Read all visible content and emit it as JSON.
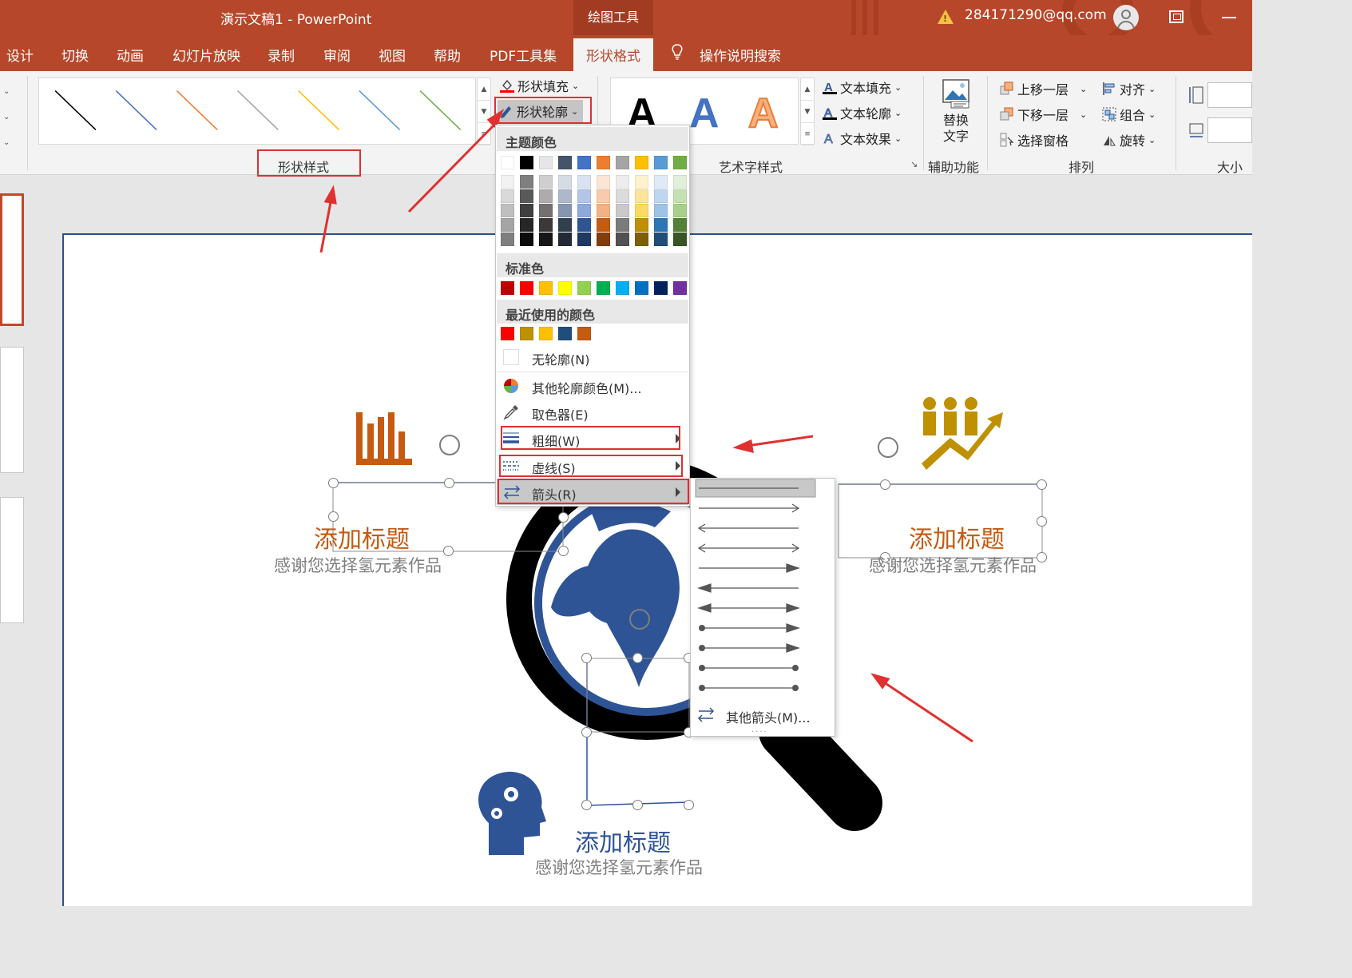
{
  "titlebar": {
    "title": "演示文稿1  -  PowerPoint",
    "context_tool": "绘图工具",
    "account": "284171290@qq.com"
  },
  "tabs": [
    {
      "label": "设计"
    },
    {
      "label": "切换"
    },
    {
      "label": "动画"
    },
    {
      "label": "幻灯片放映"
    },
    {
      "label": "录制"
    },
    {
      "label": "审阅"
    },
    {
      "label": "视图"
    },
    {
      "label": "帮助"
    },
    {
      "label": "PDF工具集"
    },
    {
      "label": "形状格式"
    }
  ],
  "search_tab": "操作说明搜索",
  "ribbon": {
    "shape_fill": "形状填充",
    "shape_outline": "形状轮廓",
    "shape_styles_label": "形状样式",
    "text_fill": "文本填充",
    "text_outline": "文本轮廓",
    "text_effect": "文本效果",
    "wordart_label": "艺术字样式",
    "alt_text_line1": "替换",
    "alt_text_line2": "文字",
    "accessibility_label": "辅助功能",
    "bring_forward": "上移一层",
    "send_backward": "下移一层",
    "selection_pane": "选择窗格",
    "align": "对齐",
    "group": "组合",
    "rotate": "旋转",
    "arrange_label": "排列",
    "size_label": "大小",
    "line_styles": [
      "#000000",
      "#4472c4",
      "#ed7d31",
      "#a5a5a5",
      "#ffc000",
      "#5b9bd5",
      "#70ad47"
    ]
  },
  "dropdown": {
    "theme_colors_header": "主题颜色",
    "theme_top": [
      "#ffffff",
      "#000000",
      "#e7e6e6",
      "#44546a",
      "#4472c4",
      "#ed7d31",
      "#a5a5a5",
      "#ffc000",
      "#5b9bd5",
      "#70ad47"
    ],
    "theme_shades": [
      [
        "#f2f2f2",
        "#7f7f7f",
        "#d0cece",
        "#d6dce4",
        "#d9e2f3",
        "#fbe5d5",
        "#ededed",
        "#fff2cc",
        "#deebf6",
        "#e2efd9"
      ],
      [
        "#d9d9d9",
        "#595959",
        "#aeabab",
        "#adb9ca",
        "#b4c6e7",
        "#f7cbac",
        "#dbdbdb",
        "#fee599",
        "#bdd7ee",
        "#c5e0b3"
      ],
      [
        "#bfbfbf",
        "#3f3f3f",
        "#757070",
        "#8496b0",
        "#8eaadb",
        "#f4b183",
        "#c9c9c9",
        "#ffd965",
        "#9dc3e6",
        "#a8d08d"
      ],
      [
        "#a5a5a5",
        "#262626",
        "#3a3838",
        "#323f4f",
        "#2f5496",
        "#c55a11",
        "#7b7b7b",
        "#bf9000",
        "#2e75b5",
        "#538135"
      ],
      [
        "#7f7f7f",
        "#0c0c0c",
        "#171616",
        "#222a35",
        "#1f3864",
        "#833c0b",
        "#525252",
        "#7f6000",
        "#1e4e79",
        "#375623"
      ]
    ],
    "standard_header": "标准色",
    "standard_colors": [
      "#c00000",
      "#ff0000",
      "#ffc000",
      "#ffff00",
      "#92d050",
      "#00b050",
      "#00b0f0",
      "#0070c0",
      "#002060",
      "#7030a0"
    ],
    "recent_header": "最近使用的颜色",
    "recent_colors": [
      "#ff0000",
      "#bf9000",
      "#ffc000",
      "#1f4e79",
      "#c55a11"
    ],
    "no_outline": "无轮廓(N)",
    "more_colors": "其他轮廓颜色(M)...",
    "eyedropper": "取色器(E)",
    "weight": "粗细(W)",
    "dashes": "虚线(S)",
    "arrows": "箭头(R)"
  },
  "submenu": {
    "more_arrows": "其他箭头(M)..."
  },
  "slide": {
    "title_left": "添加标题",
    "sub_left": "感谢您选择氢元素作品",
    "title_right": "添加标题",
    "sub_right": "感谢您选择氢元素作品",
    "title_bottom": "添加标题",
    "sub_bottom": "感谢您选择氢元素作品",
    "colors": {
      "orange": "#c55a11",
      "blue": "#2f5496",
      "gold": "#bf9000",
      "black": "#000000"
    }
  }
}
